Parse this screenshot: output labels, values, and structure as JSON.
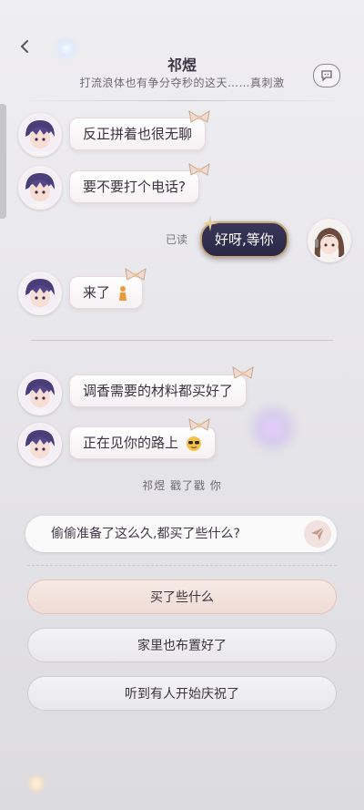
{
  "header": {
    "title": "祁煜",
    "subtitle": "打流浪体也有争分夺秒的这天……真刺激"
  },
  "messages": [
    {
      "from": "contact",
      "text": "反正拼着也很无聊"
    },
    {
      "from": "contact",
      "text": "要不要打个电话?"
    },
    {
      "from": "me",
      "text": "好呀,等你",
      "status": "已读"
    },
    {
      "from": "contact",
      "text": "来了"
    },
    {
      "from": "contact",
      "text": "调香需要的材料都买好了"
    },
    {
      "from": "contact",
      "text": "正在见你的路上"
    }
  ],
  "system_message": "祁煜 戳了戳 你",
  "input": {
    "text": "偷偷准备了这么久,都买了些什么?"
  },
  "options": [
    {
      "label": "买了些什么",
      "selected": true
    },
    {
      "label": "家里也布置好了",
      "selected": false
    },
    {
      "label": "听到有人开始庆祝了",
      "selected": false
    }
  ],
  "colors": {
    "my_bubble": "#2f2c4d",
    "bubble_border": "#c8a878",
    "selected_option": "#f2e1db"
  }
}
